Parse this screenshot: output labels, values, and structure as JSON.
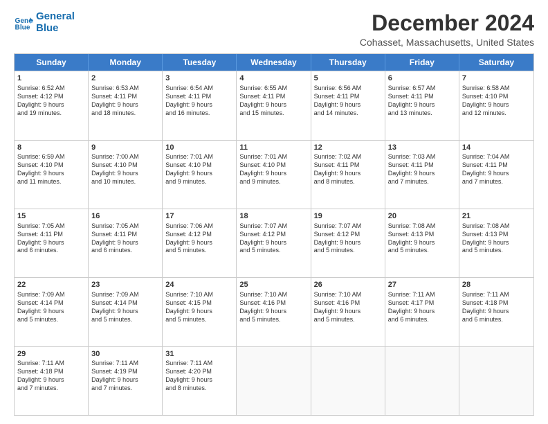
{
  "header": {
    "logo_line1": "General",
    "logo_line2": "Blue",
    "title": "December 2024",
    "subtitle": "Cohasset, Massachusetts, United States"
  },
  "days": [
    "Sunday",
    "Monday",
    "Tuesday",
    "Wednesday",
    "Thursday",
    "Friday",
    "Saturday"
  ],
  "rows": [
    [
      {
        "day": "1",
        "lines": [
          "Sunrise: 6:52 AM",
          "Sunset: 4:12 PM",
          "Daylight: 9 hours",
          "and 19 minutes."
        ]
      },
      {
        "day": "2",
        "lines": [
          "Sunrise: 6:53 AM",
          "Sunset: 4:11 PM",
          "Daylight: 9 hours",
          "and 18 minutes."
        ]
      },
      {
        "day": "3",
        "lines": [
          "Sunrise: 6:54 AM",
          "Sunset: 4:11 PM",
          "Daylight: 9 hours",
          "and 16 minutes."
        ]
      },
      {
        "day": "4",
        "lines": [
          "Sunrise: 6:55 AM",
          "Sunset: 4:11 PM",
          "Daylight: 9 hours",
          "and 15 minutes."
        ]
      },
      {
        "day": "5",
        "lines": [
          "Sunrise: 6:56 AM",
          "Sunset: 4:11 PM",
          "Daylight: 9 hours",
          "and 14 minutes."
        ]
      },
      {
        "day": "6",
        "lines": [
          "Sunrise: 6:57 AM",
          "Sunset: 4:11 PM",
          "Daylight: 9 hours",
          "and 13 minutes."
        ]
      },
      {
        "day": "7",
        "lines": [
          "Sunrise: 6:58 AM",
          "Sunset: 4:10 PM",
          "Daylight: 9 hours",
          "and 12 minutes."
        ]
      }
    ],
    [
      {
        "day": "8",
        "lines": [
          "Sunrise: 6:59 AM",
          "Sunset: 4:10 PM",
          "Daylight: 9 hours",
          "and 11 minutes."
        ]
      },
      {
        "day": "9",
        "lines": [
          "Sunrise: 7:00 AM",
          "Sunset: 4:10 PM",
          "Daylight: 9 hours",
          "and 10 minutes."
        ]
      },
      {
        "day": "10",
        "lines": [
          "Sunrise: 7:01 AM",
          "Sunset: 4:10 PM",
          "Daylight: 9 hours",
          "and 9 minutes."
        ]
      },
      {
        "day": "11",
        "lines": [
          "Sunrise: 7:01 AM",
          "Sunset: 4:10 PM",
          "Daylight: 9 hours",
          "and 9 minutes."
        ]
      },
      {
        "day": "12",
        "lines": [
          "Sunrise: 7:02 AM",
          "Sunset: 4:11 PM",
          "Daylight: 9 hours",
          "and 8 minutes."
        ]
      },
      {
        "day": "13",
        "lines": [
          "Sunrise: 7:03 AM",
          "Sunset: 4:11 PM",
          "Daylight: 9 hours",
          "and 7 minutes."
        ]
      },
      {
        "day": "14",
        "lines": [
          "Sunrise: 7:04 AM",
          "Sunset: 4:11 PM",
          "Daylight: 9 hours",
          "and 7 minutes."
        ]
      }
    ],
    [
      {
        "day": "15",
        "lines": [
          "Sunrise: 7:05 AM",
          "Sunset: 4:11 PM",
          "Daylight: 9 hours",
          "and 6 minutes."
        ]
      },
      {
        "day": "16",
        "lines": [
          "Sunrise: 7:05 AM",
          "Sunset: 4:11 PM",
          "Daylight: 9 hours",
          "and 6 minutes."
        ]
      },
      {
        "day": "17",
        "lines": [
          "Sunrise: 7:06 AM",
          "Sunset: 4:12 PM",
          "Daylight: 9 hours",
          "and 5 minutes."
        ]
      },
      {
        "day": "18",
        "lines": [
          "Sunrise: 7:07 AM",
          "Sunset: 4:12 PM",
          "Daylight: 9 hours",
          "and 5 minutes."
        ]
      },
      {
        "day": "19",
        "lines": [
          "Sunrise: 7:07 AM",
          "Sunset: 4:12 PM",
          "Daylight: 9 hours",
          "and 5 minutes."
        ]
      },
      {
        "day": "20",
        "lines": [
          "Sunrise: 7:08 AM",
          "Sunset: 4:13 PM",
          "Daylight: 9 hours",
          "and 5 minutes."
        ]
      },
      {
        "day": "21",
        "lines": [
          "Sunrise: 7:08 AM",
          "Sunset: 4:13 PM",
          "Daylight: 9 hours",
          "and 5 minutes."
        ]
      }
    ],
    [
      {
        "day": "22",
        "lines": [
          "Sunrise: 7:09 AM",
          "Sunset: 4:14 PM",
          "Daylight: 9 hours",
          "and 5 minutes."
        ]
      },
      {
        "day": "23",
        "lines": [
          "Sunrise: 7:09 AM",
          "Sunset: 4:14 PM",
          "Daylight: 9 hours",
          "and 5 minutes."
        ]
      },
      {
        "day": "24",
        "lines": [
          "Sunrise: 7:10 AM",
          "Sunset: 4:15 PM",
          "Daylight: 9 hours",
          "and 5 minutes."
        ]
      },
      {
        "day": "25",
        "lines": [
          "Sunrise: 7:10 AM",
          "Sunset: 4:16 PM",
          "Daylight: 9 hours",
          "and 5 minutes."
        ]
      },
      {
        "day": "26",
        "lines": [
          "Sunrise: 7:10 AM",
          "Sunset: 4:16 PM",
          "Daylight: 9 hours",
          "and 5 minutes."
        ]
      },
      {
        "day": "27",
        "lines": [
          "Sunrise: 7:11 AM",
          "Sunset: 4:17 PM",
          "Daylight: 9 hours",
          "and 6 minutes."
        ]
      },
      {
        "day": "28",
        "lines": [
          "Sunrise: 7:11 AM",
          "Sunset: 4:18 PM",
          "Daylight: 9 hours",
          "and 6 minutes."
        ]
      }
    ],
    [
      {
        "day": "29",
        "lines": [
          "Sunrise: 7:11 AM",
          "Sunset: 4:18 PM",
          "Daylight: 9 hours",
          "and 7 minutes."
        ]
      },
      {
        "day": "30",
        "lines": [
          "Sunrise: 7:11 AM",
          "Sunset: 4:19 PM",
          "Daylight: 9 hours",
          "and 7 minutes."
        ]
      },
      {
        "day": "31",
        "lines": [
          "Sunrise: 7:11 AM",
          "Sunset: 4:20 PM",
          "Daylight: 9 hours",
          "and 8 minutes."
        ]
      },
      null,
      null,
      null,
      null
    ]
  ]
}
